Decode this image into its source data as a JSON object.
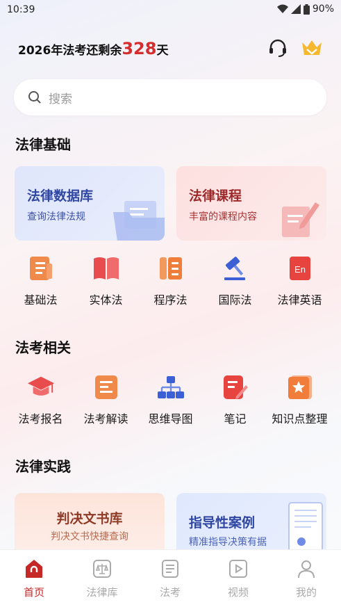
{
  "status": {
    "time": "10:39",
    "battery": "90%"
  },
  "header": {
    "countdown_prefix": "2026年法考还剩余",
    "countdown_num": "328",
    "countdown_suffix": "天"
  },
  "search": {
    "placeholder": "搜索"
  },
  "sections": {
    "basic": {
      "title": "法律基础"
    },
    "exam": {
      "title": "法考相关"
    },
    "practice": {
      "title": "法律实践"
    }
  },
  "cards": {
    "database": {
      "title": "法律数据库",
      "subtitle": "查询法律法规"
    },
    "course": {
      "title": "法律课程",
      "subtitle": "丰富的课程内容"
    },
    "judgment": {
      "title": "判决文书库",
      "subtitle": "判决文书快捷查询"
    },
    "cases": {
      "title": "指导性案例",
      "subtitle": "精准指导决策有据"
    }
  },
  "basic_items": [
    {
      "label": "基础法",
      "icon": "document-icon"
    },
    {
      "label": "实体法",
      "icon": "book-icon"
    },
    {
      "label": "程序法",
      "icon": "list-icon"
    },
    {
      "label": "国际法",
      "icon": "gavel-icon"
    },
    {
      "label": "法律英语",
      "icon": "english-icon"
    }
  ],
  "exam_items": [
    {
      "label": "法考报名",
      "icon": "graduation-cap-icon"
    },
    {
      "label": "法考解读",
      "icon": "notes-icon"
    },
    {
      "label": "思维导图",
      "icon": "mind-map-icon"
    },
    {
      "label": "笔记",
      "icon": "note-pen-icon"
    },
    {
      "label": "知识点整理",
      "icon": "star-icon"
    }
  ],
  "tabs": [
    {
      "label": "首页",
      "active": true
    },
    {
      "label": "法律库",
      "active": false
    },
    {
      "label": "法考",
      "active": false
    },
    {
      "label": "视频",
      "active": false
    },
    {
      "label": "我的",
      "active": false
    }
  ],
  "colors": {
    "accent": "#c62828",
    "blue_text": "#3a4fa8",
    "red_text": "#a83232"
  }
}
